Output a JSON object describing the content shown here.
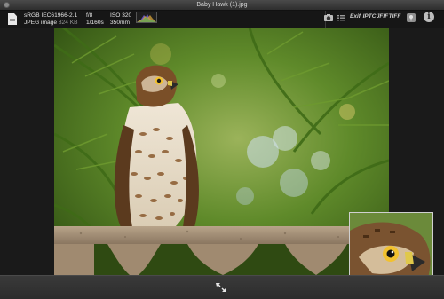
{
  "window": {
    "title": "Baby Hawk (1).jpg"
  },
  "info": {
    "color_profile": "sRGB IEC61966-2.1",
    "format": "JPEG image",
    "file_size": "824 KB",
    "aperture": "f/8",
    "shutter": "1/160s",
    "iso": "ISO 320",
    "focal_length": "350mm"
  },
  "toolbar": {
    "exif_label": "Exif",
    "iptc_label": "IPTC",
    "jfif_label": "JFIF",
    "tiff_label": "TIFF",
    "info_label": "i"
  },
  "icons": {
    "close": "close-icon",
    "file": "file-icon",
    "histogram": "histogram-icon",
    "camera": "camera-icon",
    "list": "list-icon",
    "pin": "pin-icon",
    "info": "info-icon",
    "expand": "expand-icon"
  },
  "colors": {
    "background": "#1a1a1a",
    "toolbar": "#161616",
    "text": "#e6e6e6",
    "foliage": "#4f7a1e"
  }
}
